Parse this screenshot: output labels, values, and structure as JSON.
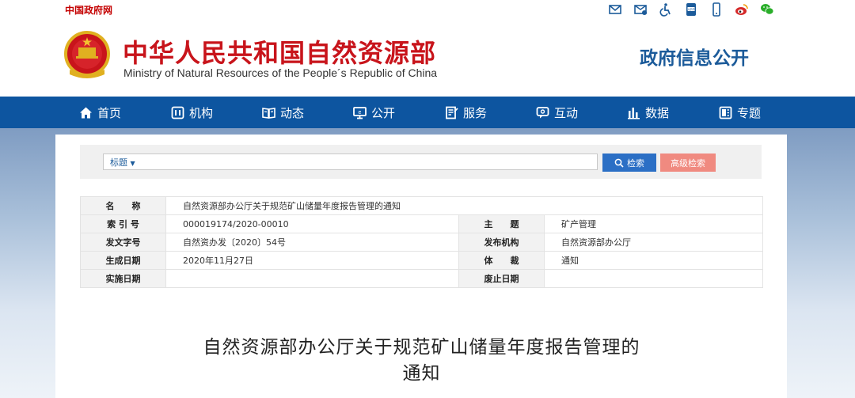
{
  "topbar": {
    "gov_link": "中国政府网",
    "icons": [
      "mail-icon",
      "message-icon",
      "accessibility-icon",
      "app-icon",
      "mobile-icon",
      "weibo-icon",
      "wechat-icon"
    ]
  },
  "header": {
    "ministry_cn": "中华人民共和国自然资源部",
    "ministry_en": "Ministry of Natural Resources of the People´s Republic of China",
    "disclosure": "政府信息公开"
  },
  "nav": [
    {
      "label": "首页",
      "icon": "home-icon"
    },
    {
      "label": "机构",
      "icon": "organization-icon"
    },
    {
      "label": "动态",
      "icon": "news-icon"
    },
    {
      "label": "公开",
      "icon": "disclosure-icon"
    },
    {
      "label": "服务",
      "icon": "service-icon"
    },
    {
      "label": "互动",
      "icon": "interaction-icon"
    },
    {
      "label": "数据",
      "icon": "chart-icon"
    },
    {
      "label": "专题",
      "icon": "topic-icon"
    }
  ],
  "search": {
    "field_label": "标题",
    "dropdown_glyph": "▼",
    "search_label": "检索",
    "advanced_label": "高级检索"
  },
  "info": {
    "name_label": "名　　称",
    "name_value": "自然资源部办公厅关于规范矿山储量年度报告管理的通知",
    "index_label": "索 引 号",
    "index_value": "000019174/2020-00010",
    "topic_label": "主　　题",
    "topic_value": "矿产管理",
    "doc_no_label": "发文字号",
    "doc_no_value": "自然资办发〔2020〕54号",
    "publisher_label": "发布机构",
    "publisher_value": "自然资源部办公厅",
    "date_label": "生成日期",
    "date_value": "2020年11月27日",
    "genre_label": "体　　裁",
    "genre_value": "通知",
    "effective_label": "实施日期",
    "effective_value": "",
    "expiry_label": "废止日期",
    "expiry_value": ""
  },
  "article": {
    "title_line1": "自然资源部办公厅关于规范矿山储量年度报告管理的",
    "title_line2": "通知"
  },
  "colors": {
    "brand_red": "#c8141b",
    "nav_blue": "#0d55a0",
    "search_blue": "#2b6fc5",
    "advanced_pink": "#f08a80"
  }
}
